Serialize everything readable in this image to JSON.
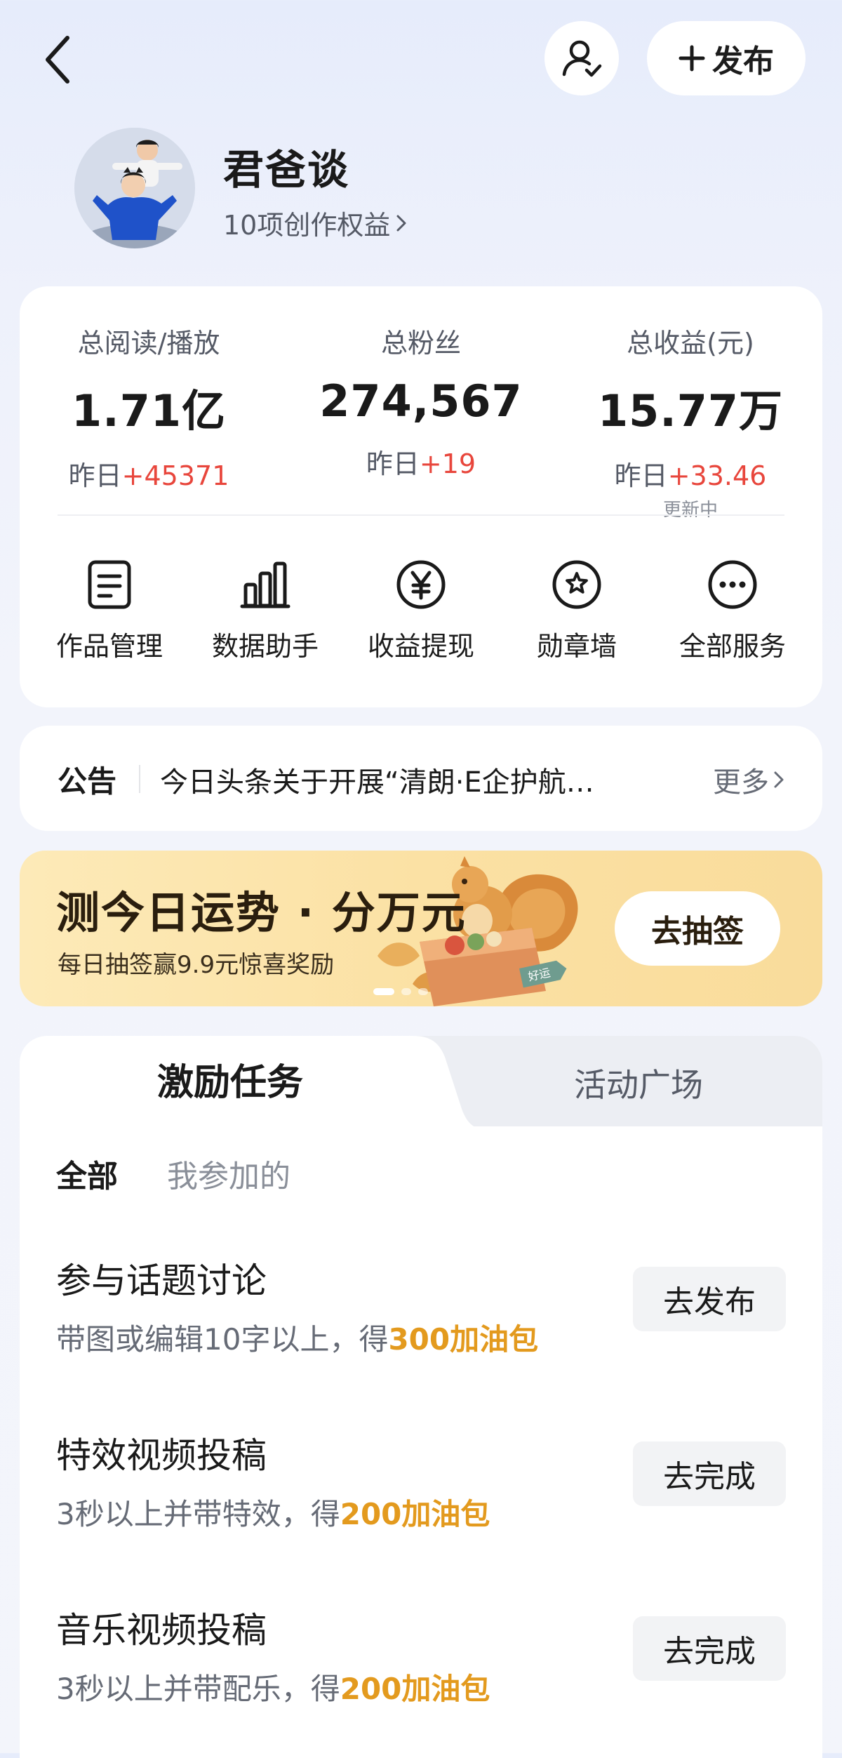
{
  "header": {
    "back_icon": "chevron-left-icon",
    "user_icon": "user-check-icon",
    "publish_label": "发布"
  },
  "profile": {
    "name": "君爸谈",
    "rights": "10项创作权益"
  },
  "stats": [
    {
      "label": "总阅读/播放",
      "value": "1.71亿",
      "delta_prefix": "昨日",
      "delta": "+45371"
    },
    {
      "label": "总粉丝",
      "value": "274,567",
      "delta_prefix": "昨日",
      "delta": "+19"
    },
    {
      "label": "总收益(元)",
      "value": "15.77万",
      "delta_prefix": "昨日",
      "delta": "+33.46",
      "note": "更新中"
    }
  ],
  "tools": [
    {
      "label": "作品管理",
      "icon": "document-icon"
    },
    {
      "label": "数据助手",
      "icon": "bar-chart-icon"
    },
    {
      "label": "收益提现",
      "icon": "yen-icon"
    },
    {
      "label": "勋章墙",
      "icon": "medal-icon"
    },
    {
      "label": "全部服务",
      "icon": "more-icon"
    }
  ],
  "notice": {
    "title": "公告",
    "text": "今日头条关于开展“清朗·E企护航…",
    "more": "更多"
  },
  "banner": {
    "title": "测今日运势 · 分万元",
    "subtitle": "每日抽签赢9.9元惊喜奖励",
    "button": "去抽签",
    "art_text": "好运"
  },
  "tabs": {
    "active": "激励任务",
    "inactive": "活动广场"
  },
  "filters": {
    "all": "全部",
    "mine": "我参加的"
  },
  "tasks": [
    {
      "title": "参与话题讨论",
      "desc": "带图或编辑10字以上，得",
      "reward": "300加油包",
      "button": "去发布"
    },
    {
      "title": "特效视频投稿",
      "desc": "3秒以上并带特效，得",
      "reward": "200加油包",
      "button": "去完成"
    },
    {
      "title": "音乐视频投稿",
      "desc": "3秒以上并带配乐，得",
      "reward": "200加油包",
      "button": "去完成"
    }
  ],
  "colors": {
    "accent_red": "#e8463c",
    "reward_orange": "#e39a1e",
    "banner_bg": "#fbe1a4"
  }
}
